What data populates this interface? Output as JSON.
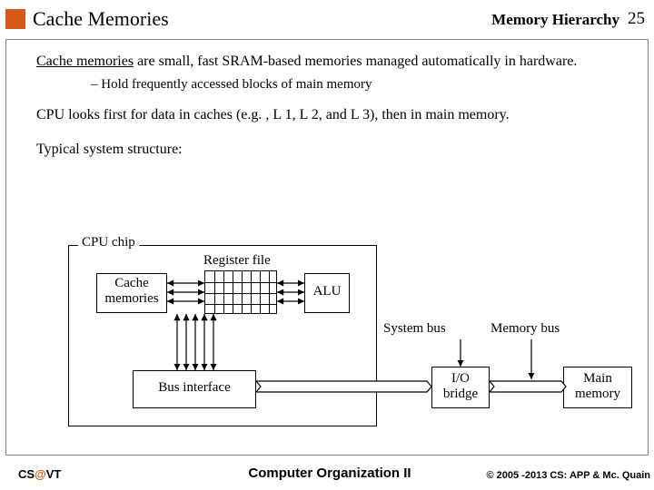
{
  "header": {
    "title": "Cache Memories",
    "chapter": "Memory Hierarchy",
    "page": "25"
  },
  "body": {
    "p1a": "Cache memories",
    "p1b": " are small, fast SRAM-based memories managed automatically in hardware.",
    "sub1": "–   Hold frequently accessed blocks of main memory",
    "p2": "CPU looks first for data in caches (e.g. , L 1, L 2, and L 3), then in main memory.",
    "p3": "Typical system structure:"
  },
  "diagram": {
    "cpu": "CPU chip",
    "regfile": "Register file",
    "cache": "Cache memories",
    "alu": "ALU",
    "busif": "Bus interface",
    "sysbus": "System bus",
    "membus": "Memory bus",
    "iobridge": "I/O bridge",
    "mainmem": "Main memory"
  },
  "footer": {
    "left_a": "CS",
    "left_b": "@",
    "left_c": "VT",
    "mid": "Computer Organization II",
    "right": "© 2005 -2013 CS: APP & Mc. Quain"
  }
}
